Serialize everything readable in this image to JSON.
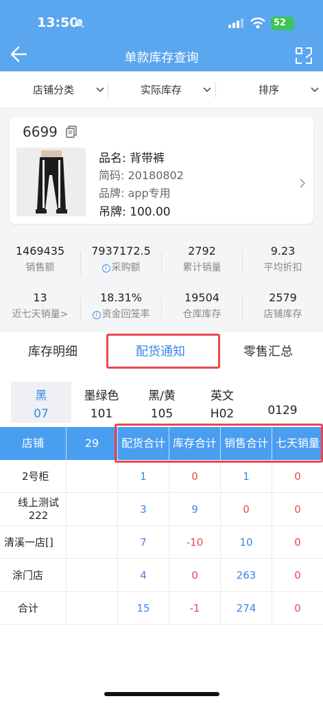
{
  "status": {
    "time": "13:50",
    "battery": "52"
  },
  "header": {
    "title": "单款库存查询"
  },
  "filters": [
    "店铺分类",
    "实际库存",
    "排序"
  ],
  "product": {
    "code": "6699",
    "name": "品名: 背带裤",
    "short_code": "简码: 20180802",
    "brand": "品牌: app专用",
    "tag_price": "吊牌: 100.00"
  },
  "stats_row1": [
    {
      "value": "1469435",
      "label": "销售额"
    },
    {
      "value": "7937172.5",
      "label": "采购额"
    },
    {
      "value": "2792",
      "label": "累计销量"
    },
    {
      "value": "9.23",
      "label": "平均折扣"
    }
  ],
  "stats_row2": [
    {
      "value": "13",
      "label": "近七天销量>"
    },
    {
      "value": "18.31%",
      "label": "资金回笼率"
    },
    {
      "value": "19504",
      "label": "仓库库存"
    },
    {
      "value": "2579",
      "label": "店铺库存"
    }
  ],
  "tabs": [
    "库存明细",
    "配货通知",
    "零售汇总"
  ],
  "colors": [
    {
      "name": "黑",
      "code": "07"
    },
    {
      "name": "墨绿色",
      "code": "101"
    },
    {
      "name": "黑/黄",
      "code": "105"
    },
    {
      "name": "英文",
      "code": "H02"
    },
    {
      "name": "",
      "code": "0129"
    }
  ],
  "table": {
    "headers": [
      "店铺",
      "29",
      "配货合计",
      "库存合计",
      "销售合计",
      "七天销量"
    ],
    "rows": [
      {
        "name": "2号柜",
        "vals": [
          "1",
          "0",
          "1",
          "0"
        ]
      },
      {
        "name": "线上测试\n222",
        "vals": [
          "3",
          "9",
          "0",
          "0"
        ]
      },
      {
        "name": "清溪一店[]",
        "vals": [
          "7",
          "-10",
          "10",
          "0"
        ]
      },
      {
        "name": "涂门店",
        "vals": [
          "4",
          "0",
          "263",
          "0"
        ]
      },
      {
        "name": "合计",
        "vals": [
          "15",
          "-1",
          "274",
          "0"
        ]
      }
    ]
  }
}
